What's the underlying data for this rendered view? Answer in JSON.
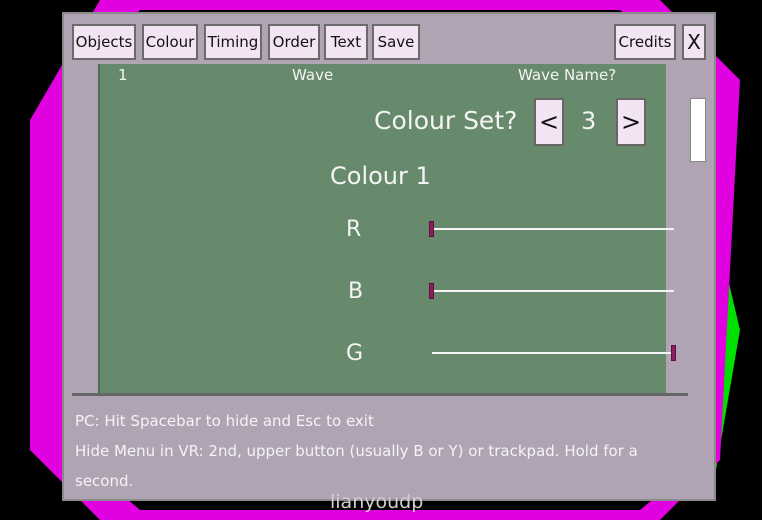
{
  "toolbar": {
    "objects": "Objects",
    "colour": "Colour",
    "timing": "Timing",
    "order": "Order",
    "text": "Text",
    "save": "Save",
    "credits": "Credits",
    "close": "X"
  },
  "panel": {
    "wave_number": "1",
    "wave_label": "Wave",
    "wave_name_label": "Wave Name?",
    "colour_set_label": "Colour Set?",
    "colour_set_prev": "<",
    "colour_set_value": "3",
    "colour_set_next": ">",
    "colour_heading": "Colour 1",
    "sliders": [
      {
        "label": "R",
        "value": 0
      },
      {
        "label": "B",
        "value": 0
      },
      {
        "label": "G",
        "value": 1
      }
    ]
  },
  "footer": {
    "line1": "PC: Hit Spacebar to hide and Esc to exit",
    "line2": "Hide Menu in VR: 2nd, upper button (usually B or Y) or trackpad. Hold for a second."
  },
  "watermark": "lianyoudp",
  "colors": {
    "background_green": "#00e000",
    "background_magenta": "#e000e0",
    "panel_green": "#678a6c",
    "window_grey": "#afa3b4",
    "button_fill": "#f2e4f2",
    "slider_knob": "#8e1d5e"
  }
}
